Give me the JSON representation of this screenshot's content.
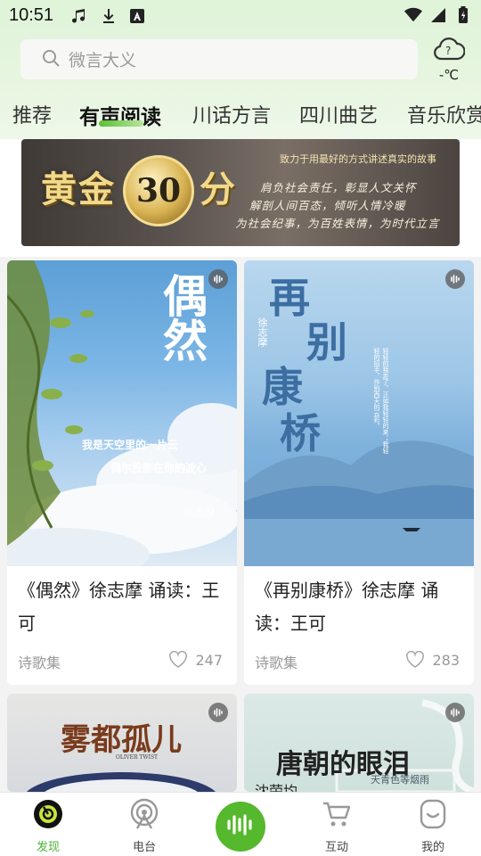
{
  "status_bar": {
    "time": "10:51",
    "left_icons": [
      "music-note-icon",
      "download-icon",
      "font-a-icon"
    ],
    "right_icons": [
      "wifi-icon",
      "signal-icon",
      "battery-icon"
    ]
  },
  "search": {
    "placeholder": "微言大义",
    "icon": "search-icon"
  },
  "weather": {
    "icon": "cloud-question-icon",
    "temperature": "-℃"
  },
  "tabs": [
    {
      "label": "推荐",
      "active": false
    },
    {
      "label": "有声阅读",
      "active": true
    },
    {
      "label": "川话方言",
      "active": false
    },
    {
      "label": "四川曲艺",
      "active": false
    },
    {
      "label": "音乐欣赏",
      "active": false
    }
  ],
  "banner": {
    "title_left": "黄金",
    "title_number": "30",
    "title_right": "分",
    "slogan": "致力于用最好的方式讲述真实的故事",
    "lines": [
      "肩负社会责任，彰显人文关怀",
      "解剖人间百态，倾听人情冷暖",
      "为社会纪事，为百姓表情，为时代立言"
    ]
  },
  "cards": [
    {
      "title": "《偶然》徐志摩 诵读：王可",
      "collection": "诗歌集",
      "likes": "247",
      "cover": {
        "big_title": "偶然",
        "line1": "我是天空里的一片云",
        "line2": "偶尔投影在你的波心",
        "author": "徐志摩"
      }
    },
    {
      "title": "《再别康桥》徐志摩 诵读：王可",
      "collection": "诗歌集",
      "likes": "283",
      "cover": {
        "big_title_1": "再",
        "big_title_2": "别",
        "big_title_3": "康",
        "big_title_4": "桥",
        "author": "徐志摩",
        "poem": "轻轻的我走了，正如我轻轻的来；我轻轻的招手，作别西天的云彩。"
      }
    },
    {
      "title": "",
      "collection": "",
      "likes": "",
      "cover": {
        "big_title": "雾都孤儿",
        "subtitle": "OLIVER TWIST"
      }
    },
    {
      "title": "",
      "collection": "",
      "likes": "",
      "cover": {
        "big_title": "唐朝的眼泪",
        "subtitle": "天青色等烟雨",
        "author_partial": "沈荣均"
      }
    }
  ],
  "bottom_nav": [
    {
      "label": "发现",
      "icon": "discover-icon",
      "active": true
    },
    {
      "label": "电台",
      "icon": "radio-icon",
      "active": false
    },
    {
      "label": "",
      "icon": "audio-wave-icon",
      "active": false
    },
    {
      "label": "互动",
      "icon": "cart-icon",
      "active": false
    },
    {
      "label": "我的",
      "icon": "profile-icon",
      "active": false
    }
  ],
  "colors": {
    "accent_green": "#56b82d",
    "active_label_green": "#4cb134",
    "header_gradient_top": "#dff4d9"
  }
}
